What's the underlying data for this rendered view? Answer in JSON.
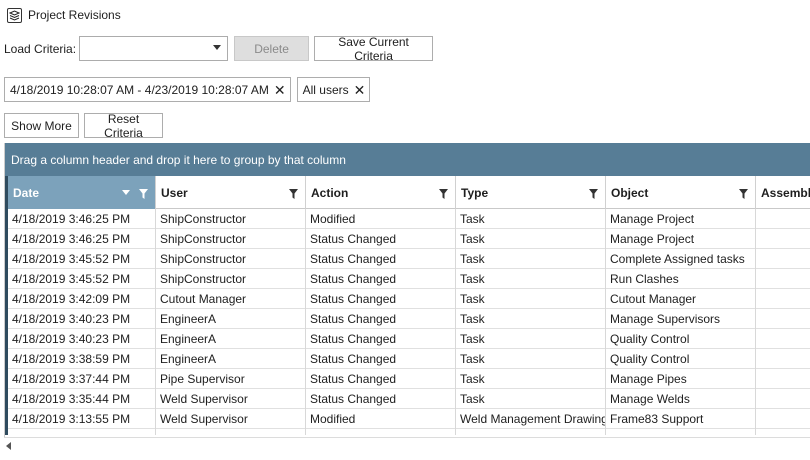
{
  "window": {
    "title": "Project Revisions"
  },
  "criteria": {
    "label": "Load Criteria:",
    "combo_value": "",
    "delete_label": "Delete",
    "save_label": "Save Current Criteria"
  },
  "filters": {
    "date_range": "4/18/2019 10:28:07 AM - 4/23/2019 10:28:07 AM",
    "users": "All users",
    "remove_glyph": "✕"
  },
  "actions": {
    "show_more_label": "Show More",
    "reset_label": "Reset Criteria"
  },
  "grid": {
    "group_panel_text": "Drag a column header and drop it here to group by that column",
    "columns": [
      "Date",
      "User",
      "Action",
      "Type",
      "Object",
      "Assembly"
    ],
    "rows": [
      [
        "4/18/2019 3:46:25 PM",
        "ShipConstructor",
        "Modified",
        "Task",
        "Manage Project",
        ""
      ],
      [
        "4/18/2019 3:46:25 PM",
        "ShipConstructor",
        "Status Changed",
        "Task",
        "Manage Project",
        ""
      ],
      [
        "4/18/2019 3:45:52 PM",
        "ShipConstructor",
        "Status Changed",
        "Task",
        "Complete Assigned tasks",
        ""
      ],
      [
        "4/18/2019 3:45:52 PM",
        "ShipConstructor",
        "Status Changed",
        "Task",
        "Run Clashes",
        ""
      ],
      [
        "4/18/2019 3:42:09 PM",
        "Cutout Manager",
        "Status Changed",
        "Task",
        "Cutout Manager",
        ""
      ],
      [
        "4/18/2019 3:40:23 PM",
        "EngineerA",
        "Status Changed",
        "Task",
        "Manage Supervisors",
        ""
      ],
      [
        "4/18/2019 3:40:23 PM",
        "EngineerA",
        "Status Changed",
        "Task",
        "Quality Control",
        ""
      ],
      [
        "4/18/2019 3:38:59 PM",
        "EngineerA",
        "Status Changed",
        "Task",
        "Quality Control",
        ""
      ],
      [
        "4/18/2019 3:37:44 PM",
        "Pipe Supervisor",
        "Status Changed",
        "Task",
        "Manage Pipes",
        ""
      ],
      [
        "4/18/2019 3:35:44 PM",
        "Weld Supervisor",
        "Status Changed",
        "Task",
        "Manage Welds",
        ""
      ],
      [
        "4/18/2019 3:13:55 PM",
        "Weld Supervisor",
        "Modified",
        "Weld Management Drawing",
        "Frame83 Support",
        ""
      ]
    ]
  },
  "colors": {
    "group_panel": "#577d96",
    "active_header": "#7ca2bb",
    "row_indicator": "#2f4b5e"
  }
}
